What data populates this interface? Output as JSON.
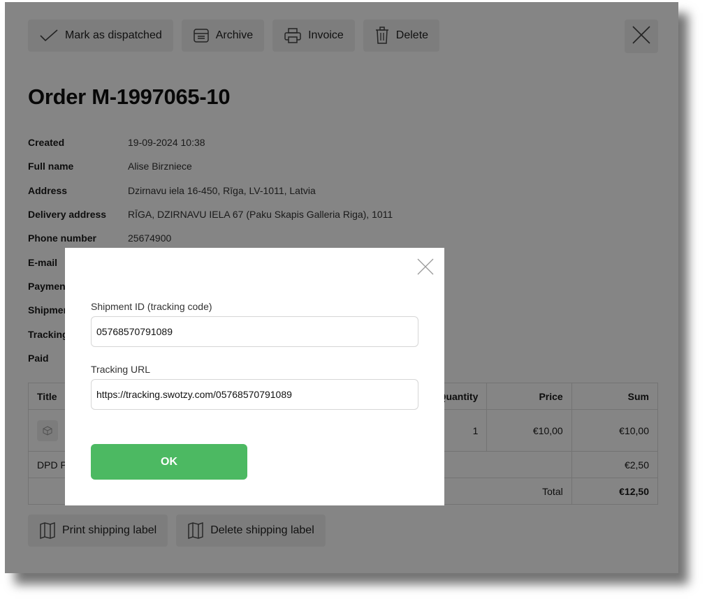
{
  "toolbar": {
    "mark_dispatched": "Mark as dispatched",
    "archive": "Archive",
    "invoice": "Invoice",
    "delete": "Delete"
  },
  "order": {
    "title": "Order M-1997065-10",
    "details": [
      {
        "label": "Created",
        "value": "19-09-2024 10:38"
      },
      {
        "label": "Full name",
        "value": "Alise Birzniece"
      },
      {
        "label": "Address",
        "value": "Dzirnavu iela 16-450, Rīga, LV-1011, Latvia"
      },
      {
        "label": "Delivery address",
        "value": "RĪGA, DZIRNAVU IELA 67 (Paku Skapis Galleria Riga), 1011"
      },
      {
        "label": "Phone number",
        "value": "25674900"
      },
      {
        "label": "E-mail",
        "value": ""
      },
      {
        "label": "Payment",
        "value": ""
      },
      {
        "label": "Shipment",
        "value": ""
      },
      {
        "label": "Tracking",
        "value": ""
      },
      {
        "label": "Paid",
        "value": ""
      }
    ]
  },
  "table": {
    "headers": {
      "title": "Title",
      "quantity": "Quantity",
      "price": "Price",
      "sum": "Sum"
    },
    "item": {
      "quantity": "1",
      "price": "€10,00",
      "sum": "€10,00"
    },
    "shipping": {
      "label": "DPD P",
      "sum": "€2,50"
    },
    "total": {
      "label": "Total",
      "sum": "€12,50"
    }
  },
  "bottom": {
    "print_label": "Print shipping label",
    "delete_label": "Delete shipping label"
  },
  "modal": {
    "shipment_id_label": "Shipment ID (tracking code)",
    "shipment_id_value": "05768570791089",
    "tracking_url_label": "Tracking URL",
    "tracking_url_value": "https://tracking.swotzy.com/05768570791089",
    "ok_label": "OK"
  },
  "colors": {
    "ok_button": "#4cb962",
    "overlay": "rgba(0,0,0,0.48)"
  }
}
